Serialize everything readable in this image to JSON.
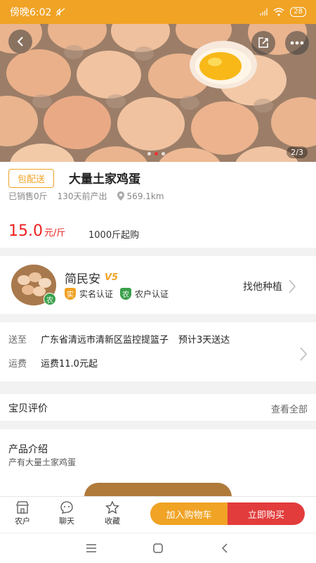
{
  "status_bar": {
    "time": "傍晚6:02",
    "battery": "28"
  },
  "hero": {
    "pager": "2/3"
  },
  "product": {
    "tag": "包配送",
    "title": "大量土家鸡蛋",
    "sold": "已销售0斤",
    "produced": "130天前产出",
    "distance": "569.1km",
    "price": "15.0",
    "price_unit": "元/斤",
    "min_order": "1000斤起购"
  },
  "seller": {
    "name": "简民安",
    "vip_label": "V5",
    "avatar_badge": "农",
    "cert_real_icon": "实",
    "cert_real": "实名认证",
    "cert_farmer_icon": "农",
    "cert_farmer": "农户认证",
    "find_link": "找他种植"
  },
  "delivery": {
    "to_label": "送至",
    "address": "广东省清远市清新区监控提篮子",
    "eta": "预计3天送达",
    "fee_label": "运费",
    "fee": "运费11.0元起"
  },
  "reviews": {
    "title": "宝贝评价",
    "view_all": "查看全部"
  },
  "intro": {
    "title": "产品介绍",
    "desc": "产有大量土家鸡蛋"
  },
  "action_bar": {
    "tab_farmer": "农户",
    "tab_chat": "聊天",
    "tab_fav": "收藏",
    "add_cart": "加入购物车",
    "buy_now": "立即购买"
  },
  "colors": {
    "accent": "#f0a325",
    "red": "#e23c3c",
    "green": "#3aa04b"
  }
}
